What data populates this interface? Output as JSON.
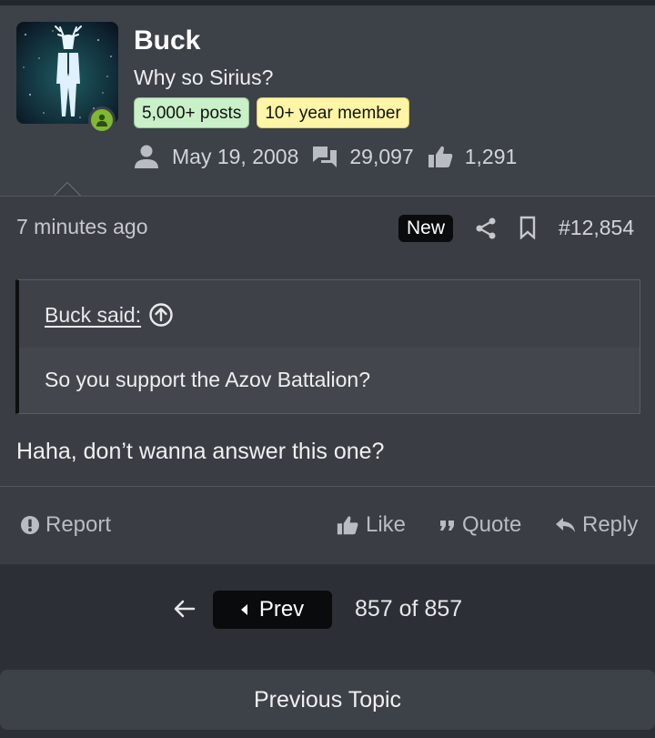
{
  "user": {
    "name": "Buck",
    "title": "Why so Sirius?",
    "badges": {
      "posts": "5,000+ posts",
      "member": "10+ year member"
    },
    "stats": {
      "joined": "May 19, 2008",
      "messages": "29,097",
      "reactions": "1,291"
    },
    "online": true
  },
  "post": {
    "time_ago": "7 minutes ago",
    "new_label": "New",
    "number": "#12,854",
    "quote": {
      "author": "Buck said:",
      "text": "So you support the Azov Battalion?"
    },
    "message": "Haha, don’t wanna answer this one?",
    "actions": {
      "report": "Report",
      "like": "Like",
      "quote": "Quote",
      "reply": "Reply"
    }
  },
  "pager": {
    "prev_label": "Prev",
    "count": "857 of 857"
  },
  "footer": {
    "previous_topic": "Previous Topic"
  },
  "colors": {
    "page_bg": "#2c3036",
    "card_bg": "#3d4148",
    "post_bg": "#3a3e44",
    "online": "#7fb934",
    "badge_posts": "#c9f0c9",
    "badge_member": "#fff5a6"
  }
}
